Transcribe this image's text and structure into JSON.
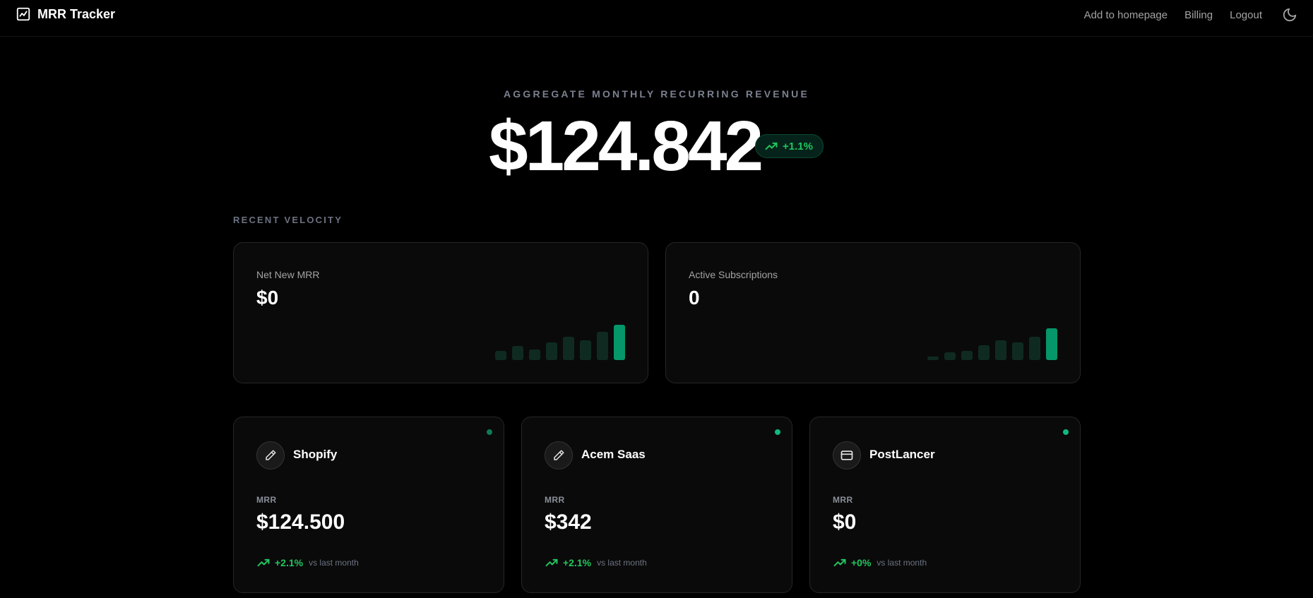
{
  "header": {
    "app_title": "MRR Tracker",
    "app_icon": "activity-chart-icon",
    "nav": [
      "Add to homepage",
      "Billing",
      "Logout"
    ],
    "theme_icon": "moon-icon"
  },
  "hero": {
    "label": "AGGREGATE MONTHLY RECURRING REVENUE",
    "value": "$124.842",
    "change": "+1.1%"
  },
  "velocity": {
    "section_label": "RECENT VELOCITY",
    "cards": [
      {
        "label": "Net New MRR",
        "value": "$0",
        "bars": [
          0.25,
          0.4,
          0.3,
          0.5,
          0.65,
          0.55,
          0.8,
          1.0
        ]
      },
      {
        "label": "Active Subscriptions",
        "value": "0",
        "bars": [
          0.1,
          0.22,
          0.25,
          0.42,
          0.55,
          0.5,
          0.65,
          0.9
        ]
      }
    ]
  },
  "sources": [
    {
      "name": "Shopify",
      "icon": "pencil-icon",
      "mrr_label": "MRR",
      "mrr_value": "$124.500",
      "change": "+2.1%",
      "compare": "vs last month"
    },
    {
      "name": "Acem Saas",
      "icon": "pencil-icon",
      "mrr_label": "MRR",
      "mrr_value": "$342",
      "change": "+2.1%",
      "compare": "vs last month"
    },
    {
      "name": "PostLancer",
      "icon": "credit-card-icon",
      "mrr_label": "MRR",
      "mrr_value": "$0",
      "change": "+0%",
      "compare": "vs last month"
    }
  ],
  "colors": {
    "accent": "#22c55e",
    "bar_active": "#059669",
    "bar_dim": "#0f2b21",
    "card_bg": "#0a0a0a",
    "border": "#262626"
  }
}
